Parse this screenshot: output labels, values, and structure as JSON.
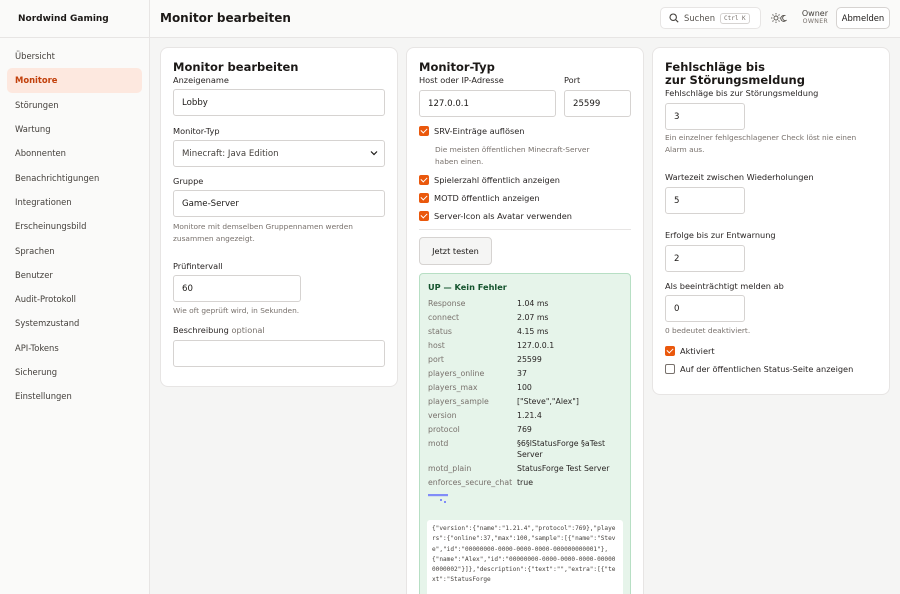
{
  "sidebar": {
    "brand": "Nordwind Gaming",
    "items": [
      {
        "label": "Übersicht",
        "active": false
      },
      {
        "label": "Monitore",
        "active": true
      },
      {
        "label": "Störungen",
        "active": false
      },
      {
        "label": "Wartung",
        "active": false
      },
      {
        "label": "Abonnenten",
        "active": false
      },
      {
        "label": "Benachrichtigungen",
        "active": false
      },
      {
        "label": "Integrationen",
        "active": false
      },
      {
        "label": "Erscheinungsbild",
        "active": false
      },
      {
        "label": "Sprachen",
        "active": false
      },
      {
        "label": "Benutzer",
        "active": false
      },
      {
        "label": "Audit-Protokoll",
        "active": false
      },
      {
        "label": "Systemzustand",
        "active": false
      },
      {
        "label": "API-Tokens",
        "active": false
      },
      {
        "label": "Sicherung",
        "active": false
      },
      {
        "label": "Einstellungen",
        "active": false
      }
    ]
  },
  "header": {
    "title": "Monitor bearbeiten",
    "search_label": "Suchen",
    "search_shortcut": "Ctrl K",
    "user_name": "Owner",
    "user_role": "OWNER",
    "logout_label": "Abmelden"
  },
  "card1": {
    "title": "Monitor bearbeiten",
    "name_label": "Anzeigename",
    "name_value": "Lobby",
    "type_label": "Monitor-Typ",
    "type_value": "Minecraft: Java Edition",
    "group_label": "Gruppe",
    "group_value": "Game-Server",
    "group_help_1": "Monitore mit demselben Gruppennamen werden",
    "group_help_2": "zusammen angezeigt.",
    "interval_label": "Prüfintervall",
    "interval_value": "60",
    "interval_help": "Wie oft geprüft wird, in Sekunden.",
    "desc_label": "Beschreibung",
    "desc_optional": "optional",
    "desc_value": ""
  },
  "card2": {
    "title": "Monitor-Typ",
    "host_label": "Host oder IP-Adresse",
    "host_value": "127.0.0.1",
    "port_label": "Port",
    "port_value": "25599",
    "srv_label": "SRV-Einträge auflösen",
    "srv_help_1": "Die meisten öffentlichen Minecraft-Server",
    "srv_help_2": "haben einen.",
    "players_label": "Spielerzahl öffentlich anzeigen",
    "motd_label": "MOTD öffentlich anzeigen",
    "icon_label": "Server-Icon als Avatar verwenden",
    "test_button": "Jetzt testen",
    "result_title": "UP — Kein Fehler",
    "result_rows": [
      {
        "k": "Response",
        "v": "1.04 ms"
      },
      {
        "k": "connect",
        "v": "2.07 ms"
      },
      {
        "k": "status",
        "v": "4.15 ms"
      },
      {
        "k": "host",
        "v": "127.0.0.1"
      },
      {
        "k": "port",
        "v": "25599"
      },
      {
        "k": "players_online",
        "v": "37"
      },
      {
        "k": "players_max",
        "v": "100"
      },
      {
        "k": "players_sample",
        "v": "[\"Steve\",\"Alex\"]"
      },
      {
        "k": "version",
        "v": "1.21.4"
      },
      {
        "k": "protocol",
        "v": "769"
      },
      {
        "k": "motd",
        "v": "§6§lStatusForge §aTest Server"
      },
      {
        "k": "motd_plain",
        "v": "StatusForge Test Server"
      },
      {
        "k": "enforces_secure_chat",
        "v": "true"
      }
    ],
    "raw_json": "{\"version\":{\"name\":\"1.21.4\",\"protocol\":769},\"players\":{\"online\":37,\"max\":100,\"sample\":[{\"name\":\"Steve\",\"id\":\"00000000-0000-0000-0000-000000000001\"},{\"name\":\"Alex\",\"id\":\"00000000-0000-0000-0000-000000000002\"}]},\"description\":{\"text\":\"\",\"extra\":[{\"text\":\"StatusForge "
  },
  "card3": {
    "title_line1": "Fehlschläge bis",
    "title_line2": "zur Störungsmeldung",
    "fail_label": "Fehlschläge bis zur Störungsmeldung",
    "fail_value": "3",
    "fail_help_1": "Ein einzelner fehlgeschlagener Check löst nie einen",
    "fail_help_2": "Alarm aus.",
    "retry_label": "Wartezeit zwischen Wiederholungen",
    "retry_value": "5",
    "success_label": "Erfolge bis zur Entwarnung",
    "success_value": "2",
    "degraded_label": "Als beeinträchtigt melden ab",
    "degraded_value": "0",
    "degraded_help": "0 bedeutet deaktiviert.",
    "active_label": "Aktiviert",
    "public_label": "Auf der öffentlichen Status-Seite anzeigen"
  }
}
